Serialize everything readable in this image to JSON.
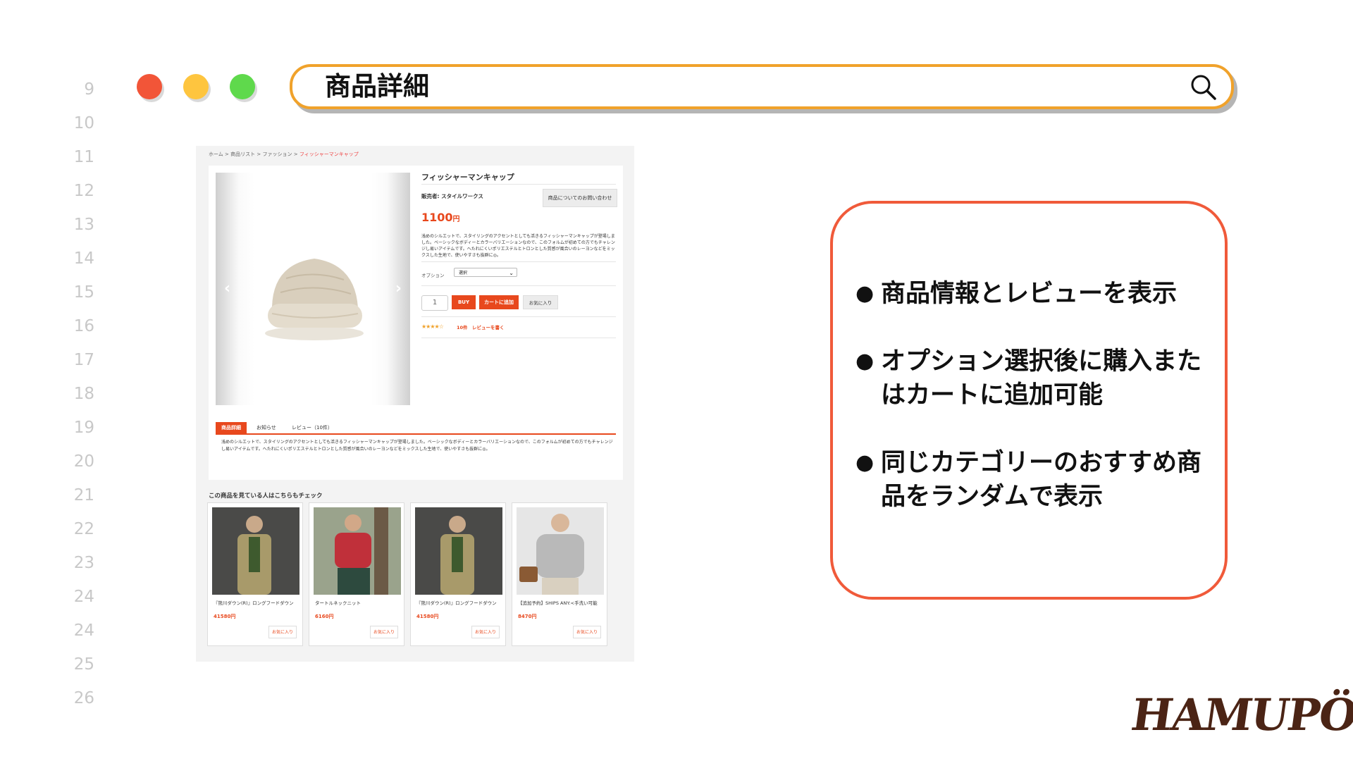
{
  "line_numbers": [
    "9",
    "10",
    "11",
    "12",
    "13",
    "14",
    "15",
    "16",
    "17",
    "18",
    "19",
    "20",
    "21",
    "22",
    "23",
    "24",
    "24",
    "25",
    "26"
  ],
  "window": {
    "title": "商品詳細"
  },
  "shot": {
    "breadcrumb": {
      "items": [
        "ホーム",
        "商品リスト",
        "ファッション"
      ],
      "current": "フィッシャーマンキャップ",
      "sep": ">"
    },
    "product": {
      "name": "フィッシャーマンキャップ",
      "seller": "販売者: スタイルワークス",
      "inquiry_button": "商品についてのお問い合わせ",
      "price": "1100",
      "currency": "円",
      "description": "浅めのシルエットで、スタイリングのアクセントとしても活きるフィッシャーマンキャップが登場しました。ベーシックなボディーとカラーバリエーションなので、このフォルムが初めての方でもチャレンジし易いアイテムです。へたれにくいポリエステルとトロンとした質感が風合いのレーヨンなどをミックスした生地で、使いやすさも抜群に◎。",
      "option_label": "オプション",
      "option_value": "選択",
      "quantity": "1",
      "buy_label": "BUY",
      "cart_label": "カートに追加",
      "favorite_label": "お気に入り",
      "stars": "★★★★☆",
      "rating": 4,
      "review_count": "10件",
      "write_review": "レビューを書く"
    },
    "tabs": [
      {
        "label": "商品詳細",
        "active": true
      },
      {
        "label": "お知らせ",
        "active": false
      },
      {
        "label": "レビュー（10件）",
        "active": false
      }
    ],
    "tab_content": "浅めのシルエットで、スタイリングのアクセントとしても活きるフィッシャーマンキャップが登場しました。ベーシックなボディーとカラーバリエーションなので、このフォルムが初めての方でもチャレンジし易いアイテムです。へたれにくいポリエステルとトロンとした質感が風合いのレーヨンなどをミックスした生地で、使いやすさも抜群に◎。",
    "recommend_title": "この商品を見ている人はこちらもチェック",
    "recommendations": [
      {
        "name": "『熊川ダウン(R)』ロングフードダウン",
        "price": "41580円",
        "fav": "お気に入り",
        "color": "#a89a6a"
      },
      {
        "name": "タートルネックニット",
        "price": "6160円",
        "fav": "お気に入り",
        "color": "#c0303a"
      },
      {
        "name": "『熊川ダウン(R)』ロングフードダウン",
        "price": "41580円",
        "fav": "お気に入り",
        "color": "#a89a6a"
      },
      {
        "name": "【追加予約】SHIPS ANY:<手洗い可能",
        "price": "8470円",
        "fav": "お気に入り",
        "color": "#b9b9b9"
      }
    ]
  },
  "features": [
    "商品情報とレビューを表示",
    "オプション選択後に購入またはカートに追加可能",
    "同じカテゴリーのおすすめ商品をランダムで表示"
  ],
  "logo": "HAMUPÖCHI",
  "colors": {
    "accent": "#e8481d",
    "search_border": "#f0a22b",
    "box_border": "#f05a3a"
  }
}
